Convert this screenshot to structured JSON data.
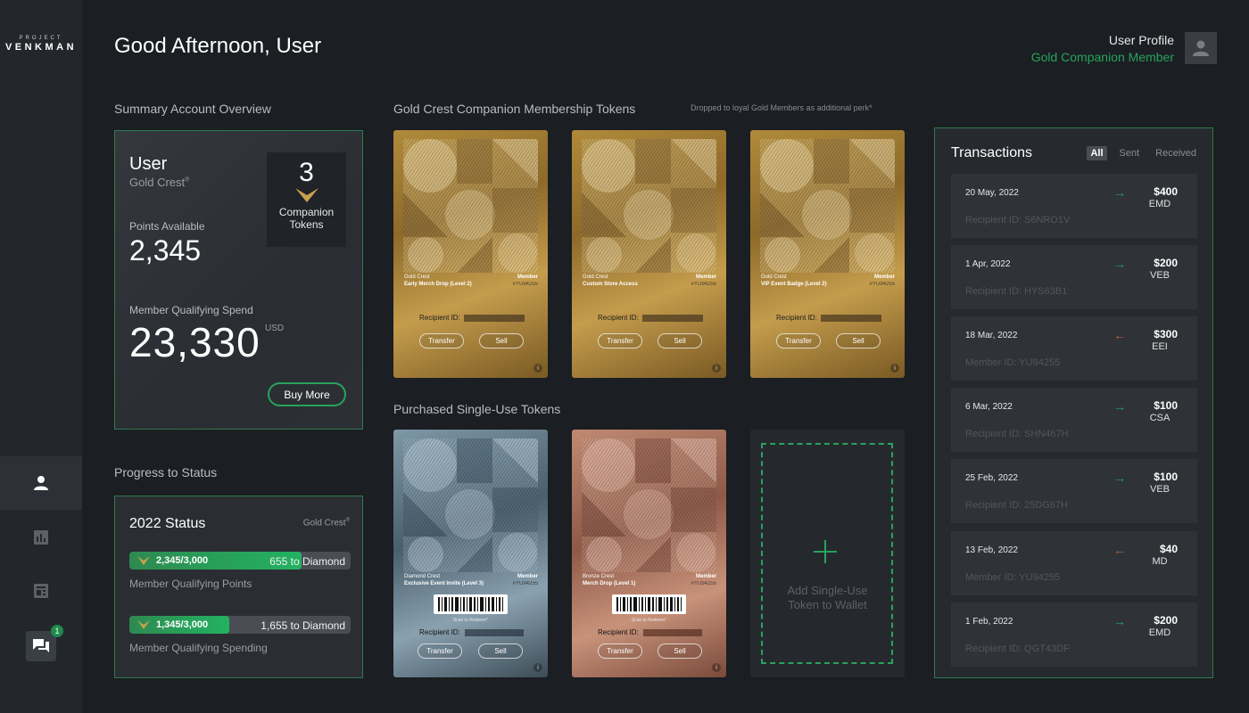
{
  "brand": {
    "small": "PROJECT",
    "big": "VENKMAN"
  },
  "header": {
    "greeting": "Good Afternoon, User",
    "profile_label": "User Profile",
    "profile_tier": "Gold Companion Member"
  },
  "nav": {
    "chat_badge": "1"
  },
  "summary": {
    "title": "Summary Account Overview",
    "user_name": "User",
    "user_tier": "Gold Crest",
    "tier_mark": "®",
    "companion_count": "3",
    "companion_label_1": "Companion",
    "companion_label_2": "Tokens",
    "points_label": "Points Available",
    "points_value": "2,345",
    "spend_label": "Member Qualifying Spend",
    "spend_value": "23,330",
    "spend_unit": "USD",
    "buy_label": "Buy More"
  },
  "status": {
    "section_title": "Progress to Status",
    "title": "2022 Status",
    "tier": "Gold Crest",
    "tier_mark": "®",
    "bars": [
      {
        "value": "2,345/3,000",
        "rest": "655 to Diamond",
        "label": "Member Qualifying Points",
        "progress": 0.78
      },
      {
        "value": "1,345/3,000",
        "rest": "1,655 to Diamond",
        "label": "Member Qualifying Spending",
        "progress": 0.45
      }
    ]
  },
  "companion_tokens": {
    "title": "Gold Crest Companion Membership Tokens",
    "note": "Dropped to loyal Gold Members as additional perk*",
    "items": [
      {
        "crest": "Gold Crest",
        "name": "Early Merch Drop (Level 2)",
        "member": "Member",
        "id": "#YU94255",
        "recipient": "Recipient ID:",
        "transfer": "Transfer",
        "sell": "Sell"
      },
      {
        "crest": "Gold Crest",
        "name": "Custom Store Access",
        "member": "Member",
        "id": "#YU94255",
        "recipient": "Recipient ID:",
        "transfer": "Transfer",
        "sell": "Sell"
      },
      {
        "crest": "Gold Crest",
        "name": "VIP Event Badge (Level 2)",
        "member": "Member",
        "id": "#YU94255",
        "recipient": "Recipient ID:",
        "transfer": "Transfer",
        "sell": "Sell"
      }
    ]
  },
  "single_tokens": {
    "title": "Purchased Single-Use Tokens",
    "items": [
      {
        "crest": "Diamond Crest",
        "name": "Exclusive Event Invite (Level 3)",
        "member": "Member",
        "id": "#YU94255",
        "scan": "Scan to Redeem*",
        "recipient": "Recipient ID:",
        "transfer": "Transfer",
        "sell": "Sell"
      },
      {
        "crest": "Bronze Crest",
        "name": "Merch Drop (Level 1)",
        "member": "Member",
        "id": "#YU94255",
        "scan": "Scan to Redeem*",
        "recipient": "Recipient ID:",
        "transfer": "Transfer",
        "sell": "Sell"
      }
    ],
    "add_line1": "Add Single-Use",
    "add_line2": "Token to Wallet"
  },
  "transactions": {
    "title": "Transactions",
    "filters": [
      "All",
      "Sent",
      "Received"
    ],
    "colors": {
      "sent": "#27a35b",
      "received": "#b5623f"
    },
    "rows": [
      {
        "date": "20 May, 2022",
        "direction": "sent",
        "arrow": "→",
        "amount": "$400",
        "currency": "EMD",
        "rid": "Recipient ID: S6NRO1V"
      },
      {
        "date": "1 Apr, 2022",
        "direction": "sent",
        "arrow": "→",
        "amount": "$200",
        "currency": "VEB",
        "rid": "Recipient ID: HYS63B1"
      },
      {
        "date": "18 Mar, 2022",
        "direction": "received",
        "arrow": "←",
        "amount": "$300",
        "currency": "EEI",
        "rid": "Member ID: YU94255"
      },
      {
        "date": "6 Mar, 2022",
        "direction": "sent",
        "arrow": "→",
        "amount": "$100",
        "currency": "CSA",
        "rid": "Recipient ID: SHN467H"
      },
      {
        "date": "25 Feb, 2022",
        "direction": "sent",
        "arrow": "→",
        "amount": "$100",
        "currency": "VEB",
        "rid": "Recipient ID: 25DG67H"
      },
      {
        "date": "13 Feb, 2022",
        "direction": "received",
        "arrow": "←",
        "amount": "$40",
        "currency": "MD",
        "rid": "Member ID: YU94255"
      },
      {
        "date": "1 Feb, 2022",
        "direction": "sent",
        "arrow": "→",
        "amount": "$200",
        "currency": "EMD",
        "rid": "Recipient ID: QGT43DF"
      }
    ]
  }
}
